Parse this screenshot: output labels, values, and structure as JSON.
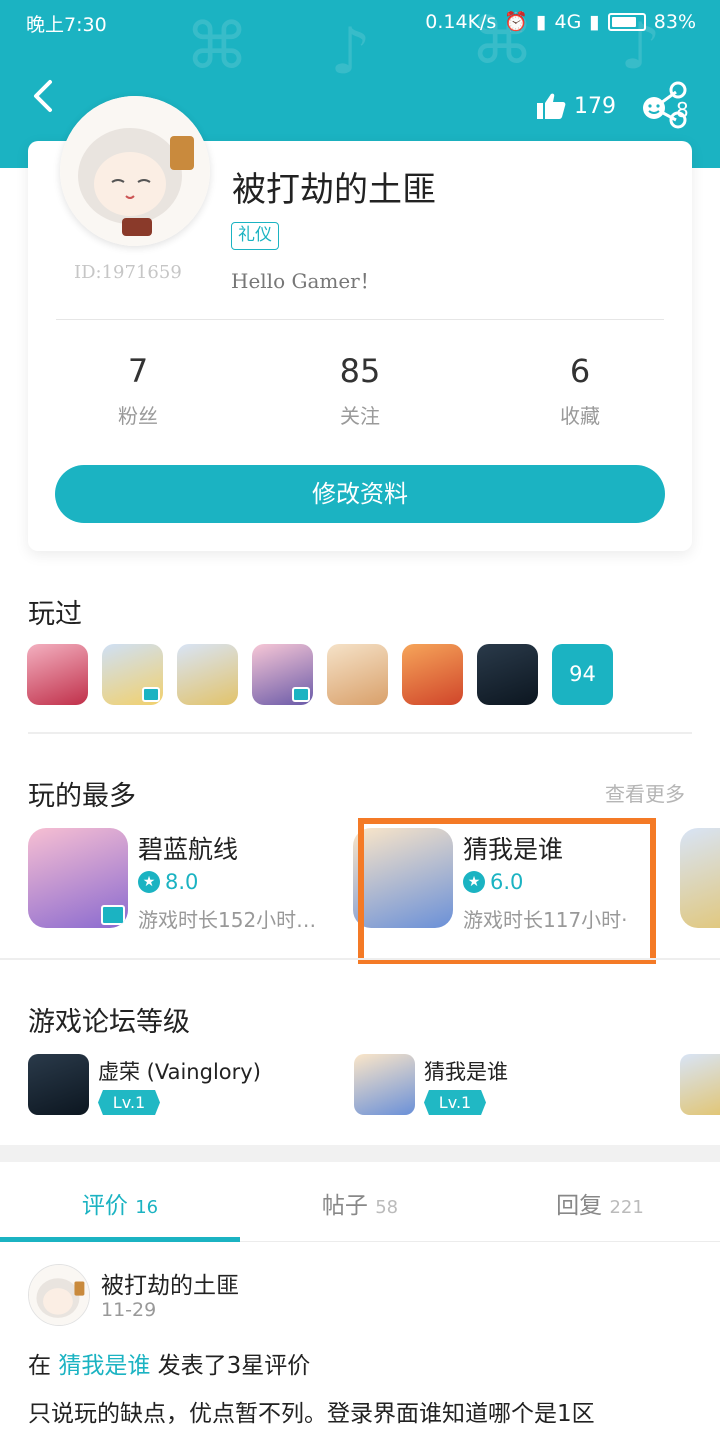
{
  "status_bar": {
    "time": "晚上7:30",
    "net_speed": "0.14K/s",
    "network": "4G",
    "battery": "83%",
    "battery_level": 0.83
  },
  "header": {
    "likes": "179",
    "share_count": "8"
  },
  "profile": {
    "username": "被打劫的土匪",
    "tag": "礼仪",
    "user_id": "ID:1971659",
    "bio": "Hello Gamer！",
    "stats": [
      {
        "value": "7",
        "label": "粉丝"
      },
      {
        "value": "85",
        "label": "关注"
      },
      {
        "value": "6",
        "label": "收藏"
      }
    ],
    "edit_button": "修改资料"
  },
  "played": {
    "title": "玩过",
    "more_count": "94"
  },
  "most_played": {
    "title": "玩的最多",
    "see_more": "查看更多",
    "items": [
      {
        "name": "碧蓝航线",
        "rating": "8.0",
        "time": "游戏时长152小时…"
      },
      {
        "name": "猜我是谁",
        "rating": "6.0",
        "time": "游戏时长117小时·"
      }
    ]
  },
  "forum_level": {
    "title": "游戏论坛等级",
    "items": [
      {
        "name": "虚荣 (Vainglory)",
        "level": "Lv.1"
      },
      {
        "name": "猜我是谁",
        "level": "Lv.1"
      }
    ]
  },
  "tabs": [
    {
      "label": "评价",
      "count": "16"
    },
    {
      "label": "帖子",
      "count": "58"
    },
    {
      "label": "回复",
      "count": "221"
    }
  ],
  "review": {
    "user": "被打劫的土匪",
    "date": "11-29",
    "prefix": "在",
    "game": "猜我是谁",
    "suffix": "发表了3星评价",
    "text": "只说玩的缺点，优点暂不列。登录界面谁知道哪个是1区"
  },
  "colors": {
    "accent": "#1bb3c2",
    "highlight": "#f47a26"
  }
}
